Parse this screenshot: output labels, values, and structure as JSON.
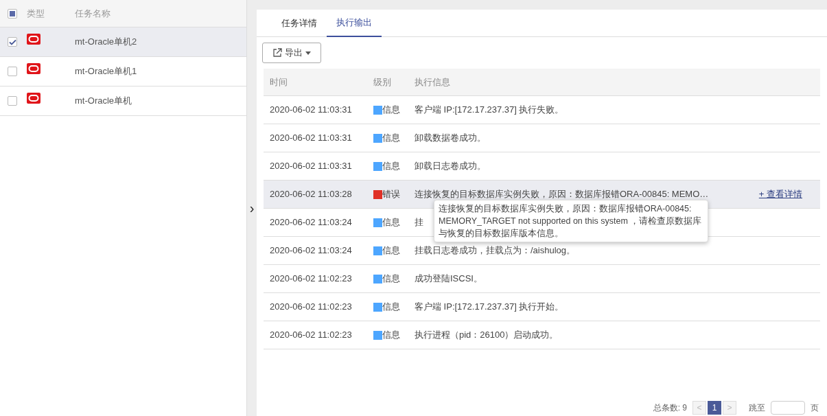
{
  "task_list": {
    "select_all": {
      "indeterminate": true
    },
    "columns": [
      "类型",
      "任务名称"
    ],
    "rows": [
      {
        "name": "mt-Oracle单机2",
        "checked": true,
        "selected": true
      },
      {
        "name": "mt-Oracle单机1",
        "checked": false,
        "selected": false
      },
      {
        "name": "mt-Oracle单机",
        "checked": false,
        "selected": false
      }
    ]
  },
  "collapse_toggle": "›",
  "tabs": [
    {
      "label": "任务详情",
      "selected": false
    },
    {
      "label": "执行输出",
      "selected": true
    }
  ],
  "export_button": "导出",
  "log_table": {
    "columns": [
      "时间",
      "级别",
      "执行信息"
    ],
    "rows": [
      {
        "time": "2020-06-02 11:03:31",
        "level": "信息",
        "color": "#4da6ff",
        "message": "客户端 IP:[172.17.237.37] 执行失败。",
        "hovered": false
      },
      {
        "time": "2020-06-02 11:03:31",
        "level": "信息",
        "color": "#4da6ff",
        "message": "卸载数据卷成功。",
        "hovered": false
      },
      {
        "time": "2020-06-02 11:03:31",
        "level": "信息",
        "color": "#4da6ff",
        "message": "卸载日志卷成功。",
        "hovered": false
      },
      {
        "time": "2020-06-02 11:03:28",
        "level": "错误",
        "color": "#e03026",
        "message": "连接恢复的目标数据库实例失败，原因：数据库报错ORA-00845: MEMO…",
        "link": "+ 查看详情",
        "hovered": true
      },
      {
        "time": "2020-06-02 11:03:24",
        "level": "信息",
        "color": "#4da6ff",
        "message": "挂",
        "hovered": false
      },
      {
        "time": "2020-06-02 11:03:24",
        "level": "信息",
        "color": "#4da6ff",
        "message": "挂载日志卷成功，挂载点为：/aishulog。",
        "hovered": false
      },
      {
        "time": "2020-06-02 11:02:23",
        "level": "信息",
        "color": "#4da6ff",
        "message": "成功登陆ISCSI。",
        "hovered": false
      },
      {
        "time": "2020-06-02 11:02:23",
        "level": "信息",
        "color": "#4da6ff",
        "message": "客户端 IP:[172.17.237.37] 执行开始。",
        "hovered": false
      },
      {
        "time": "2020-06-02 11:02:23",
        "level": "信息",
        "color": "#4da6ff",
        "message": "执行进程（pid：26100）启动成功。",
        "hovered": false
      }
    ]
  },
  "tooltip": "连接恢复的目标数据库实例失败，原因：数据库报错ORA-00845: MEMORY_TARGET not supported on this system ，请检查原数据库与恢复的目标数据库版本信息。",
  "pagination": {
    "total_label": "总条数: 9",
    "prev": "<",
    "pages": [
      {
        "label": "1",
        "selected": true
      }
    ],
    "next": ">",
    "goto_label": "跳至",
    "page_suffix": "页"
  }
}
